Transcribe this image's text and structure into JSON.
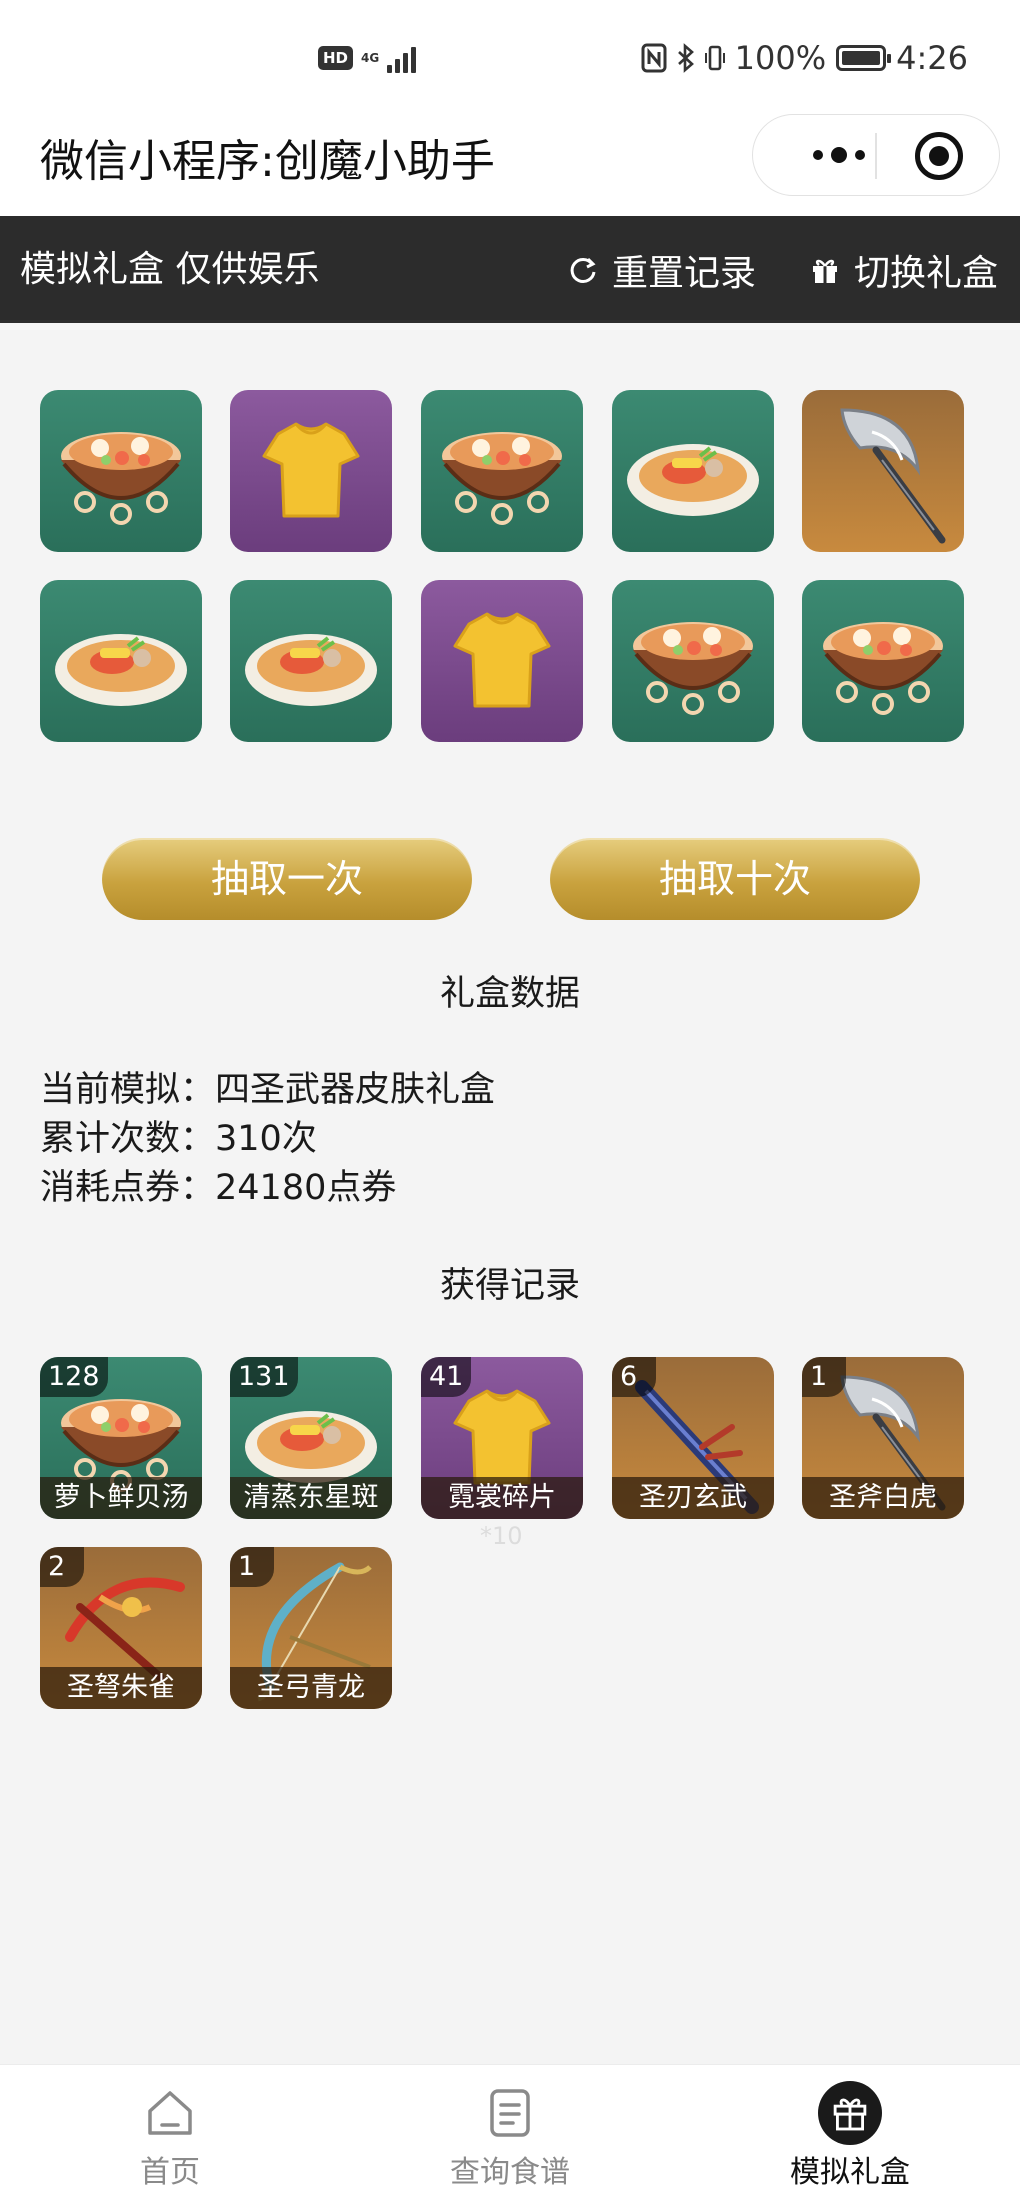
{
  "status_bar": {
    "hd": "HD",
    "network": "4G",
    "battery": "100%",
    "time": "4:26"
  },
  "titlebar": {
    "title": "微信小程序:创魔小助手"
  },
  "header": {
    "left_text": "模拟礼盒 仅供娱乐",
    "reset_label": "重置记录",
    "switch_label": "切换礼盒"
  },
  "draw_results": [
    {
      "item": "萝卜鲜贝汤",
      "icon": "soup-icon",
      "bg": "green"
    },
    {
      "item": "霓裳碎片",
      "icon": "shirt-icon",
      "bg": "purple"
    },
    {
      "item": "萝卜鲜贝汤",
      "icon": "soup-icon",
      "bg": "green"
    },
    {
      "item": "清蒸东星斑",
      "icon": "fish-dish-icon",
      "bg": "green"
    },
    {
      "item": "圣斧白虎",
      "icon": "axe-icon",
      "bg": "orange"
    },
    {
      "item": "清蒸东星斑",
      "icon": "fish-dish-icon",
      "bg": "green"
    },
    {
      "item": "清蒸东星斑",
      "icon": "fish-dish-icon",
      "bg": "green"
    },
    {
      "item": "霓裳碎片",
      "icon": "shirt-icon",
      "bg": "purple"
    },
    {
      "item": "萝卜鲜贝汤",
      "icon": "soup-icon",
      "bg": "green"
    },
    {
      "item": "萝卜鲜贝汤",
      "icon": "soup-icon",
      "bg": "green"
    }
  ],
  "buttons": {
    "draw_once": "抽取一次",
    "draw_ten": "抽取十次"
  },
  "stats": {
    "title": "礼盒数据",
    "current_label": "当前模拟：",
    "current_value": "四圣武器皮肤礼盒",
    "count_label": "累计次数：",
    "count_value": "310次",
    "cost_label": "消耗点券：",
    "cost_value": "24180点券"
  },
  "records": {
    "title": "获得记录",
    "items": [
      {
        "count": "128",
        "name": "萝卜鲜贝汤",
        "icon": "soup-icon",
        "bg": "green"
      },
      {
        "count": "131",
        "name": "清蒸东星斑",
        "icon": "fish-dish-icon",
        "bg": "green"
      },
      {
        "count": "41",
        "name": "霓裳碎片",
        "icon": "shirt-icon",
        "bg": "purple"
      },
      {
        "count": "6",
        "name": "圣刃玄武",
        "icon": "blade-icon",
        "bg": "orange"
      },
      {
        "count": "1",
        "name": "圣斧白虎",
        "icon": "axe-icon",
        "bg": "orange"
      },
      {
        "count": "2",
        "name": "圣弩朱雀",
        "icon": "crossbow-icon",
        "bg": "orange"
      },
      {
        "count": "1",
        "name": "圣弓青龙",
        "icon": "bow-icon",
        "bg": "orange"
      }
    ],
    "note": "*10"
  },
  "tabbar": {
    "home": "首页",
    "recipes": "查询食谱",
    "giftbox": "模拟礼盒",
    "active": "giftbox"
  },
  "colors": {
    "header_bg": "#2c2c2c",
    "gold": "#c9a23e",
    "green_tile": "#2a6f5a",
    "purple_tile": "#6b3d7d",
    "orange_tile": "#c88a3e"
  }
}
